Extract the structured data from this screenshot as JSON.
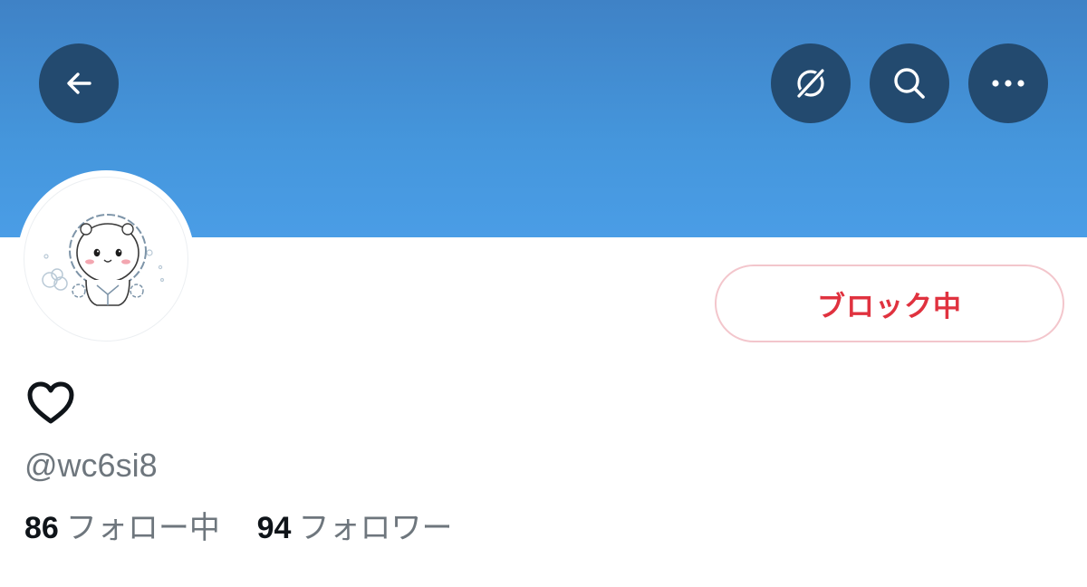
{
  "header": {
    "banner_color": "#4596dc",
    "button_color": "#234a6f",
    "buttons": [
      {
        "name": "back",
        "icon": "arrow-left-icon"
      },
      {
        "name": "grok",
        "icon": "grok-icon"
      },
      {
        "name": "search",
        "icon": "search-icon"
      },
      {
        "name": "more",
        "icon": "more-horizontal-icon"
      }
    ]
  },
  "profile": {
    "avatar": "chiikawa-character-avatar",
    "display_name_icon": "heart-outline-icon",
    "handle": "@wc6si8",
    "block_button_label": "ブロック中",
    "block_button_color": "#e0323f",
    "following_count": "86",
    "following_label": "フォロー中",
    "followers_count": "94",
    "followers_label": "フォロワー"
  }
}
